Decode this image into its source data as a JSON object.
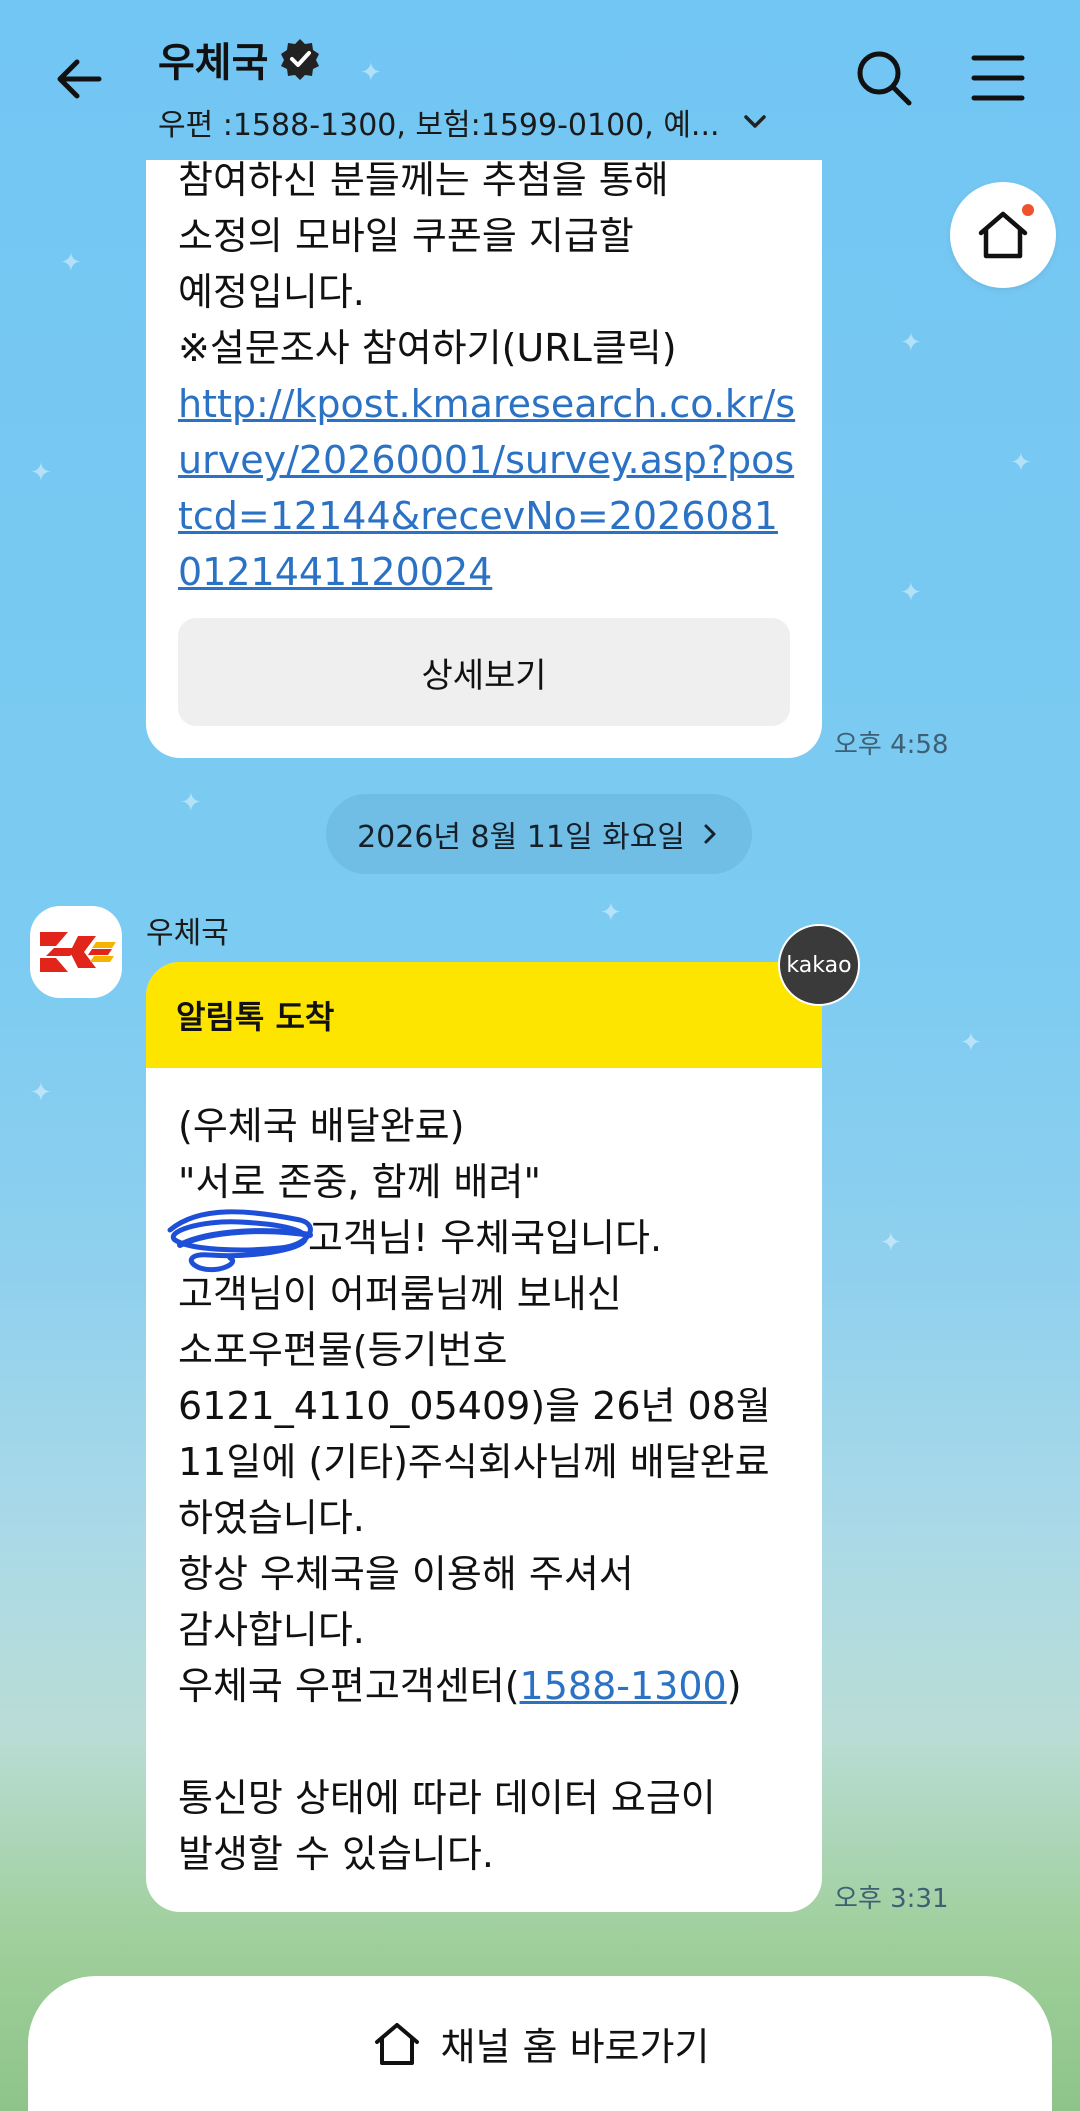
{
  "header": {
    "back_icon": "back-arrow-icon",
    "title": "우체국",
    "verified_icon": "verified-badge-icon",
    "subtitle": "우편 :1588-1300, 보험:1599-0100, 예...",
    "expand_icon": "chevron-down-icon",
    "search_icon": "search-icon",
    "menu_icon": "hamburger-menu-icon"
  },
  "home_button": {
    "icon": "home-icon",
    "has_notification": true,
    "notification_color": "#f0522d"
  },
  "message1": {
    "lines": [
      "참여하신 분들께는 추첨을 통해",
      "소정의 모바일 쿠폰을 지급할",
      "예정입니다.",
      "※설문조사 참여하기(URL클릭)"
    ],
    "link": "http://kpost.kmaresearch.co.kr/survey/20260001/survey.asp?postcd=12144&recevNo=20260810121441120024",
    "detail_button": "상세보기",
    "time": "오후 4:58"
  },
  "date_divider": {
    "label": "2026년 8월 11일 화요일",
    "icon": "chevron-right-icon"
  },
  "message2": {
    "sender": "우체국",
    "avatar_icon": "korea-post-logo-icon",
    "header": "알림톡 도착",
    "badge": "kakao",
    "lines": [
      "(우체국 배달완료)",
      "\"서로 존중, 함께 배려\"",
      "고객님! 우체국입니다.",
      "고객님이 어퍼룸님께 보내신",
      "소포우편물(등기번호",
      "6121_4110_05409)을 26년 08월",
      "11일에 (기타)주식회사님께 배달완료",
      "하였습니다.",
      "항상 우체국을 이용해 주셔서",
      "감사합니다."
    ],
    "center_prefix": "우체국 우편고객센터(",
    "center_phone": "1588-1300",
    "center_suffix": ")",
    "footer_lines": [
      "통신망 상태에 따라 데이터 요금이",
      "발생할 수 있습니다."
    ],
    "time": "오후 3:31"
  },
  "channel_home": {
    "label": "채널 홈 바로가기",
    "icon": "home-icon"
  },
  "colors": {
    "kakao_yellow": "#fee500",
    "link_blue": "#2b72c4",
    "background": "#72c6f3"
  }
}
